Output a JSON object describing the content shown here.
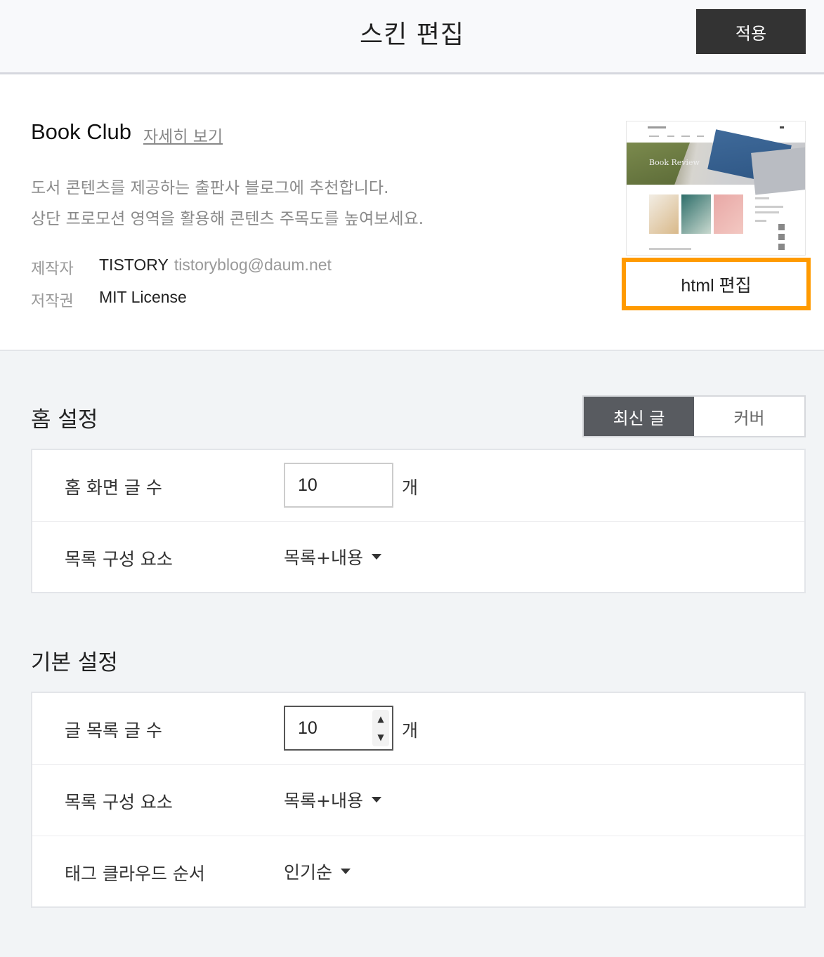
{
  "header": {
    "title": "스킨 편집",
    "apply_label": "적용"
  },
  "skin": {
    "name": "Book Club",
    "detail_link": "자세히 보기",
    "desc_line1": "도서 콘텐츠를 제공하는 출판사 블로그에 추천합니다.",
    "desc_line2": "상단 프로모션 영역을 활용해 콘텐츠 주목도를 높여보세요.",
    "author_label": "제작자",
    "author_name": "TISTORY",
    "author_email": "tistoryblog@daum.net",
    "license_label": "저작권",
    "license_value": "MIT License",
    "preview_hero_text": "Book Review",
    "html_edit_label": "html 편집"
  },
  "home_settings": {
    "title": "홈 설정",
    "tabs": [
      {
        "label": "최신 글",
        "active": true
      },
      {
        "label": "커버",
        "active": false
      }
    ],
    "rows": {
      "post_count_label": "홈 화면 글 수",
      "post_count_value": "10",
      "post_count_unit": "개",
      "list_component_label": "목록 구성 요소",
      "list_component_value": "목록+내용"
    }
  },
  "basic_settings": {
    "title": "기본 설정",
    "rows": {
      "list_count_label": "글 목록 글 수",
      "list_count_value": "10",
      "list_count_unit": "개",
      "list_component_label": "목록 구성 요소",
      "list_component_value": "목록+내용",
      "tag_order_label": "태그 클라우드 순서",
      "tag_order_value": "인기순"
    }
  },
  "colors": {
    "accent_highlight": "#ff9a00",
    "apply_button_bg": "#333333",
    "active_tab_bg": "#585b60"
  }
}
